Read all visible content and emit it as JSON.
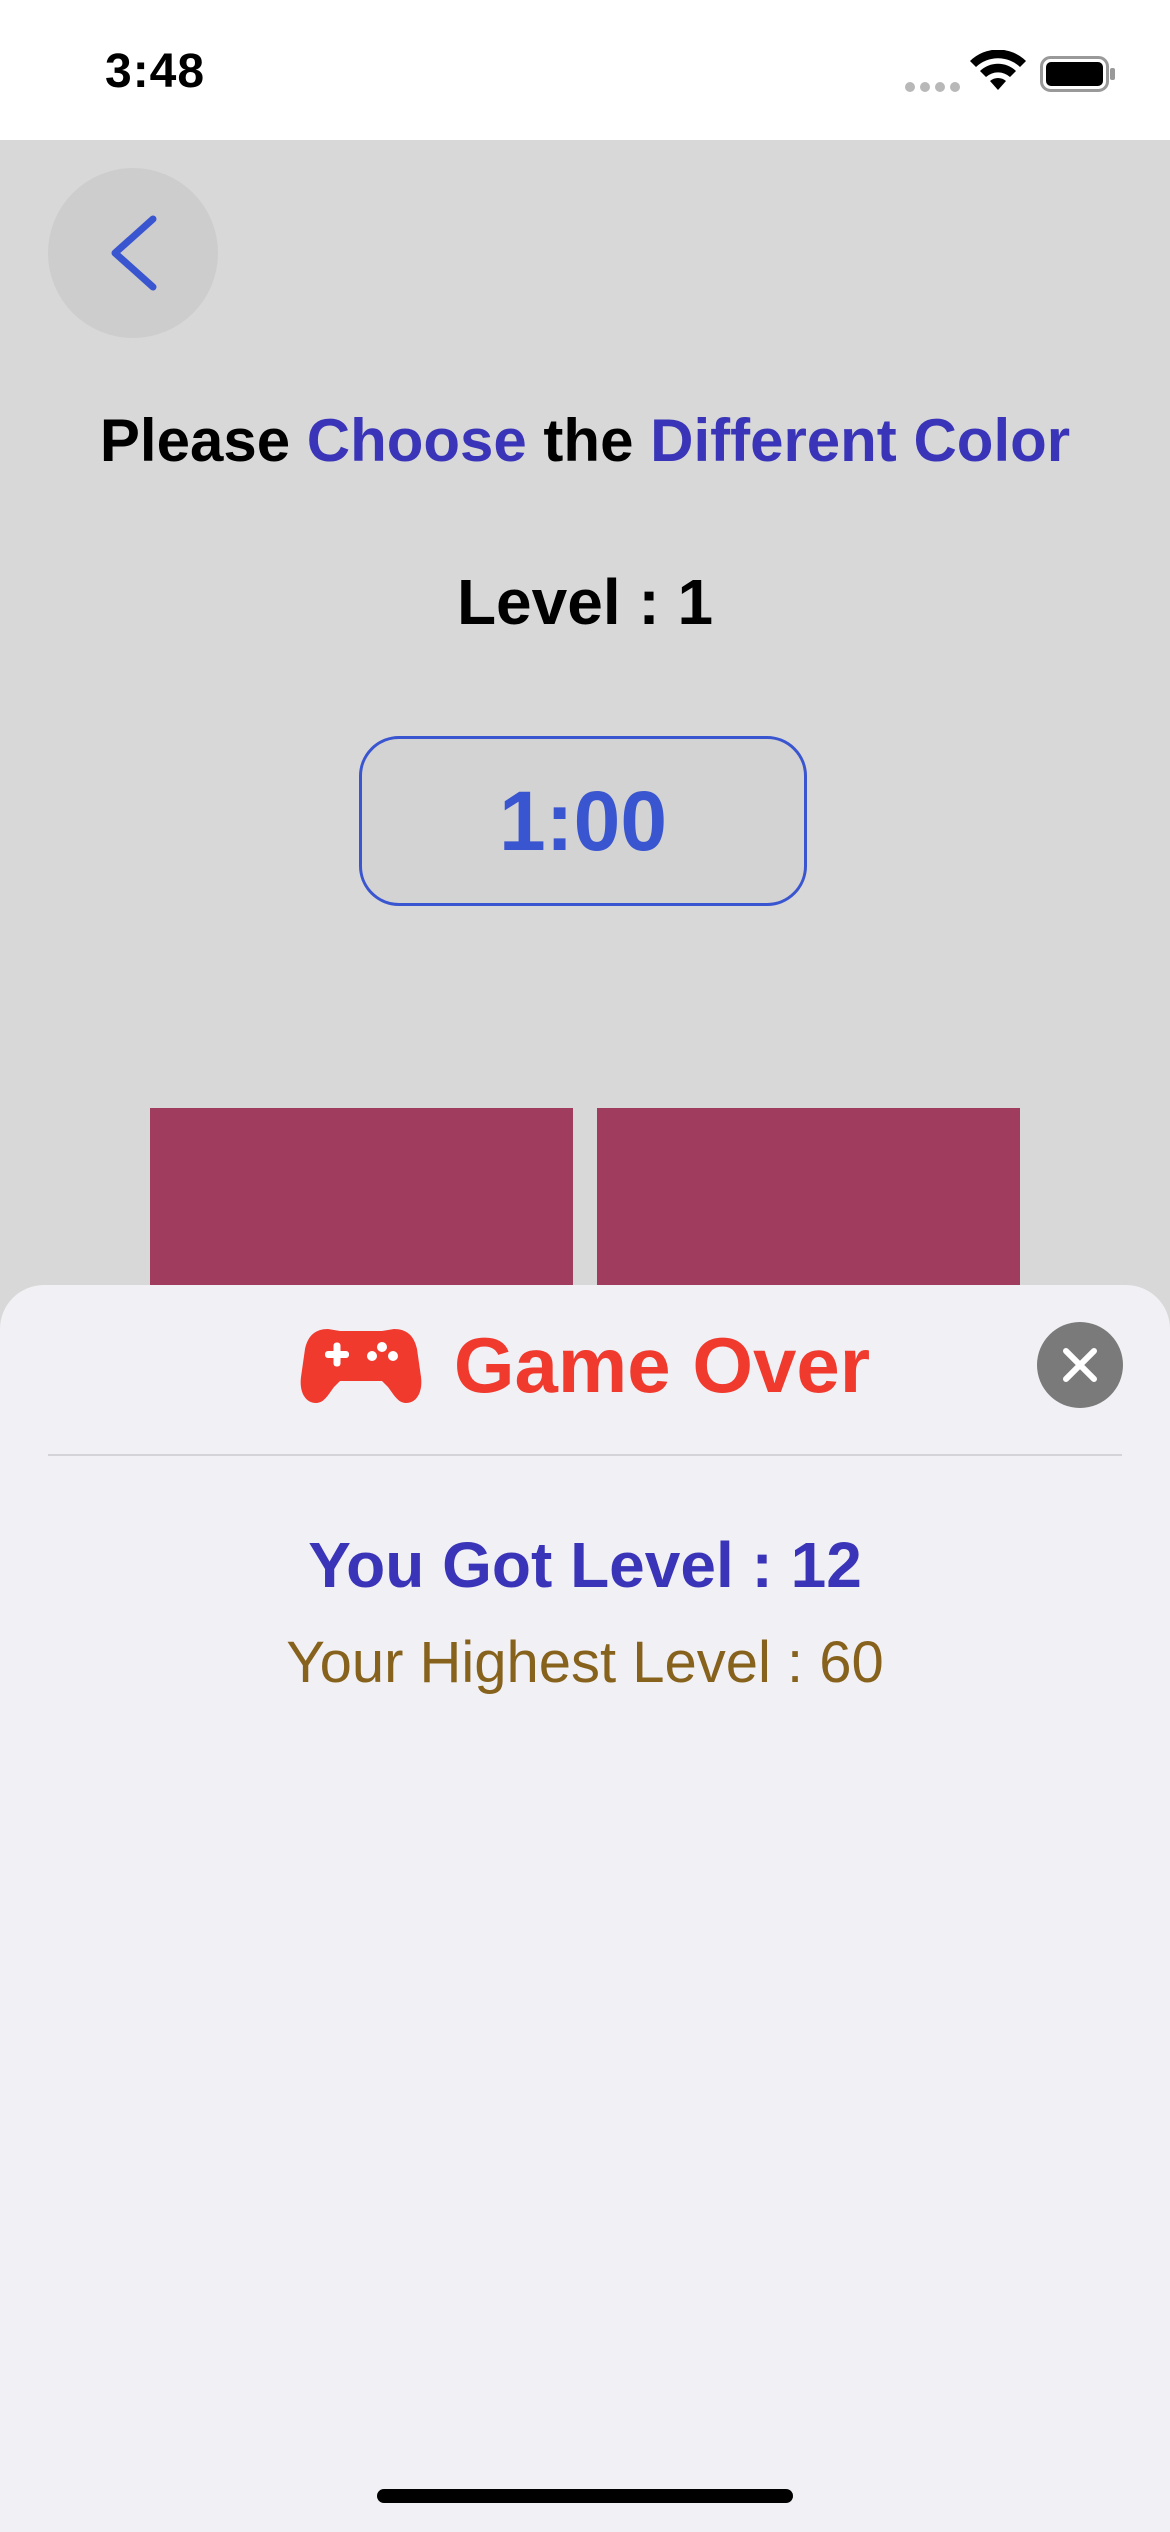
{
  "status_bar": {
    "time": "3:48",
    "icons": [
      "cellular-signal-icon",
      "wifi-icon",
      "battery-icon"
    ]
  },
  "game": {
    "back_icon": "chevron-left-icon",
    "instruction": {
      "part1": "Please ",
      "part2": "Choose",
      "part3": " the ",
      "part4": "Different Color"
    },
    "level_label": "Level : 1",
    "timer": "1:00",
    "tile_color": "#a03c5e"
  },
  "game_over_sheet": {
    "icon": "gamepad-icon",
    "title": "Game Over",
    "close_icon": "close-icon",
    "result": "You Got Level : 12",
    "highest": "Your Highest Level : 60"
  },
  "colors": {
    "accent_blue": "#3a55d0",
    "accent_indigo": "#3a35b8",
    "title_red": "#f03a2e",
    "highest_gold": "#86621c",
    "sheet_bg": "#f1f0f5",
    "game_bg": "#d8d8d8"
  }
}
